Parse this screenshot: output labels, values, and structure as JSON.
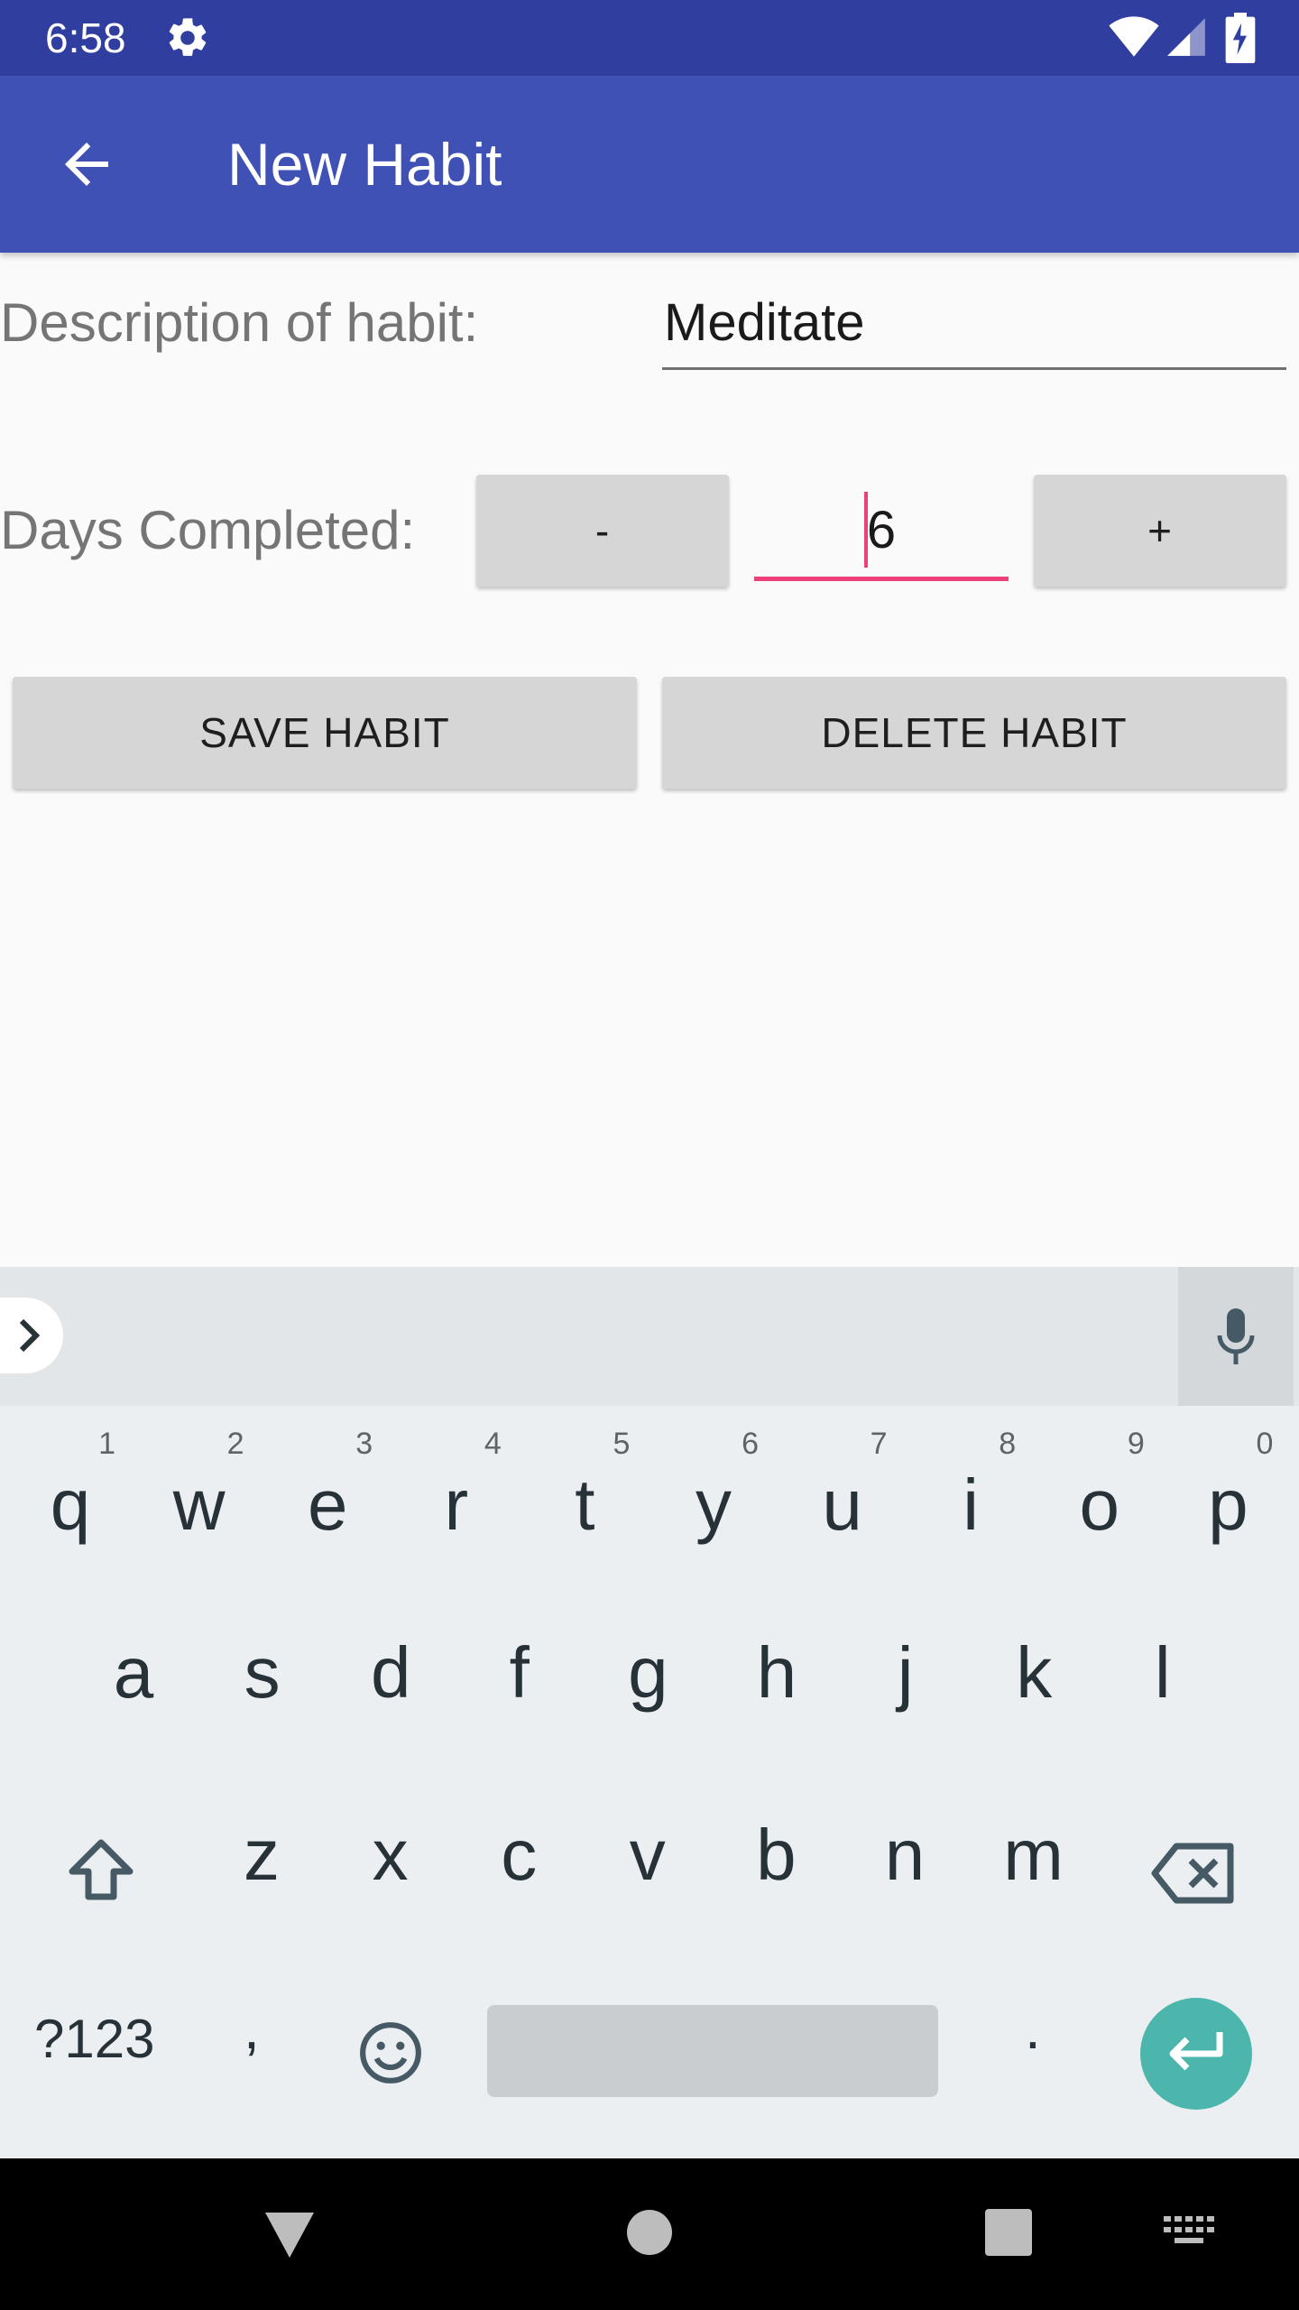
{
  "status_bar": {
    "time": "6:58",
    "icons": [
      "settings-gear-icon",
      "wifi-icon",
      "cell-signal-icon",
      "battery-charging-icon"
    ]
  },
  "app_bar": {
    "title": "New Habit",
    "back_icon": "arrow-back-icon",
    "color": "#3f51b5"
  },
  "form": {
    "description_label": "Description of habit:",
    "description_value": "Meditate",
    "days_label": "Days Completed:",
    "minus_label": "-",
    "days_value": "6",
    "plus_label": "+",
    "save_label": "SAVE HABIT",
    "delete_label": "DELETE HABIT",
    "focus_color": "#ec407a"
  },
  "keyboard": {
    "row1": [
      {
        "ch": "q",
        "hint": "1"
      },
      {
        "ch": "w",
        "hint": "2"
      },
      {
        "ch": "e",
        "hint": "3"
      },
      {
        "ch": "r",
        "hint": "4"
      },
      {
        "ch": "t",
        "hint": "5"
      },
      {
        "ch": "y",
        "hint": "6"
      },
      {
        "ch": "u",
        "hint": "7"
      },
      {
        "ch": "i",
        "hint": "8"
      },
      {
        "ch": "o",
        "hint": "9"
      },
      {
        "ch": "p",
        "hint": "0"
      }
    ],
    "row2": [
      "a",
      "s",
      "d",
      "f",
      "g",
      "h",
      "j",
      "k",
      "l"
    ],
    "row3": [
      "z",
      "x",
      "c",
      "v",
      "b",
      "n",
      "m"
    ],
    "symbols_label": "?123",
    "comma": ",",
    "period": ".",
    "enter_color": "#4db6ac"
  },
  "nav_bar": {
    "icons": [
      "back-triangle-icon",
      "home-circle-icon",
      "recents-square-icon",
      "keyboard-switch-icon"
    ]
  }
}
